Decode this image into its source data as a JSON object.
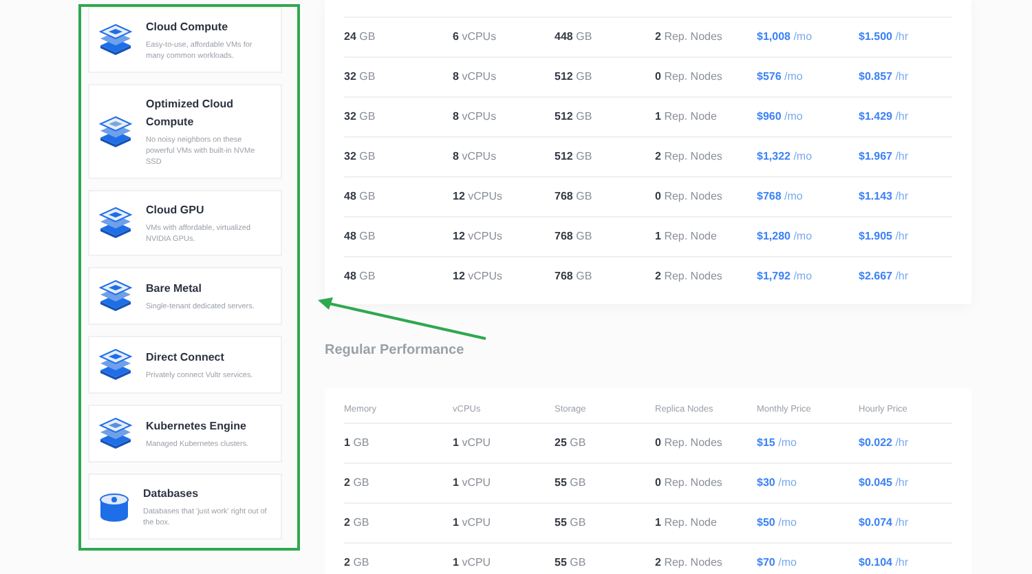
{
  "products": [
    {
      "kind": "compute",
      "title": "Cloud Compute",
      "description": "Easy-to-use, affordable VMs for many common workloads."
    },
    {
      "kind": "optimized",
      "title": "Optimized Cloud Compute",
      "description": "No noisy neighbors on these powerful VMs with built-in NVMe SSD"
    },
    {
      "kind": "gpu",
      "title": "Cloud GPU",
      "description": "VMs with affordable, virtualized NVIDIA GPUs."
    },
    {
      "kind": "metal",
      "title": "Bare Metal",
      "description": "Single-tenant dedicated servers."
    },
    {
      "kind": "connect",
      "title": "Direct Connect",
      "description": "Privately connect Vultr services."
    },
    {
      "kind": "kubernetes",
      "title": "Kubernetes Engine",
      "description": "Managed Kubernetes clusters."
    },
    {
      "kind": "database",
      "title": "Databases",
      "description": "Databases that 'just work' right out of the box."
    }
  ],
  "upper_table": {
    "rows": [
      [
        {
          "value": "24",
          "unit": "GB"
        },
        {
          "value": "6",
          "unit": "vCPUs"
        },
        {
          "value": "448",
          "unit": "GB"
        },
        {
          "value": "2",
          "unit": "Rep. Nodes"
        },
        {
          "value": "$1,008",
          "unit": "/mo"
        },
        {
          "value": "$1.500",
          "unit": "/hr"
        }
      ],
      [
        {
          "value": "32",
          "unit": "GB"
        },
        {
          "value": "8",
          "unit": "vCPUs"
        },
        {
          "value": "512",
          "unit": "GB"
        },
        {
          "value": "0",
          "unit": "Rep. Nodes"
        },
        {
          "value": "$576",
          "unit": "/mo"
        },
        {
          "value": "$0.857",
          "unit": "/hr"
        }
      ],
      [
        {
          "value": "32",
          "unit": "GB"
        },
        {
          "value": "8",
          "unit": "vCPUs"
        },
        {
          "value": "512",
          "unit": "GB"
        },
        {
          "value": "1",
          "unit": "Rep. Node"
        },
        {
          "value": "$960",
          "unit": "/mo"
        },
        {
          "value": "$1.429",
          "unit": "/hr"
        }
      ],
      [
        {
          "value": "32",
          "unit": "GB"
        },
        {
          "value": "8",
          "unit": "vCPUs"
        },
        {
          "value": "512",
          "unit": "GB"
        },
        {
          "value": "2",
          "unit": "Rep. Nodes"
        },
        {
          "value": "$1,322",
          "unit": "/mo"
        },
        {
          "value": "$1.967",
          "unit": "/hr"
        }
      ],
      [
        {
          "value": "48",
          "unit": "GB"
        },
        {
          "value": "12",
          "unit": "vCPUs"
        },
        {
          "value": "768",
          "unit": "GB"
        },
        {
          "value": "0",
          "unit": "Rep. Nodes"
        },
        {
          "value": "$768",
          "unit": "/mo"
        },
        {
          "value": "$1.143",
          "unit": "/hr"
        }
      ],
      [
        {
          "value": "48",
          "unit": "GB"
        },
        {
          "value": "12",
          "unit": "vCPUs"
        },
        {
          "value": "768",
          "unit": "GB"
        },
        {
          "value": "1",
          "unit": "Rep. Node"
        },
        {
          "value": "$1,280",
          "unit": "/mo"
        },
        {
          "value": "$1.905",
          "unit": "/hr"
        }
      ],
      [
        {
          "value": "48",
          "unit": "GB"
        },
        {
          "value": "12",
          "unit": "vCPUs"
        },
        {
          "value": "768",
          "unit": "GB"
        },
        {
          "value": "2",
          "unit": "Rep. Nodes"
        },
        {
          "value": "$1,792",
          "unit": "/mo"
        },
        {
          "value": "$2.667",
          "unit": "/hr"
        }
      ]
    ]
  },
  "section_title": "Regular Performance",
  "lower_table": {
    "columns": [
      "Memory",
      "vCPUs",
      "Storage",
      "Replica Nodes",
      "Monthly Price",
      "Hourly Price"
    ],
    "rows": [
      [
        {
          "value": "1",
          "unit": "GB"
        },
        {
          "value": "1",
          "unit": "vCPU"
        },
        {
          "value": "25",
          "unit": "GB"
        },
        {
          "value": "0",
          "unit": "Rep. Nodes"
        },
        {
          "value": "$15",
          "unit": "/mo"
        },
        {
          "value": "$0.022",
          "unit": "/hr"
        }
      ],
      [
        {
          "value": "2",
          "unit": "GB"
        },
        {
          "value": "1",
          "unit": "vCPU"
        },
        {
          "value": "55",
          "unit": "GB"
        },
        {
          "value": "0",
          "unit": "Rep. Nodes"
        },
        {
          "value": "$30",
          "unit": "/mo"
        },
        {
          "value": "$0.045",
          "unit": "/hr"
        }
      ],
      [
        {
          "value": "2",
          "unit": "GB"
        },
        {
          "value": "1",
          "unit": "vCPU"
        },
        {
          "value": "55",
          "unit": "GB"
        },
        {
          "value": "1",
          "unit": "Rep. Node"
        },
        {
          "value": "$50",
          "unit": "/mo"
        },
        {
          "value": "$0.074",
          "unit": "/hr"
        }
      ],
      [
        {
          "value": "2",
          "unit": "GB"
        },
        {
          "value": "1",
          "unit": "vCPU"
        },
        {
          "value": "55",
          "unit": "GB"
        },
        {
          "value": "2",
          "unit": "Rep. Nodes"
        },
        {
          "value": "$70",
          "unit": "/mo"
        },
        {
          "value": "$0.104",
          "unit": "/hr"
        }
      ]
    ]
  }
}
